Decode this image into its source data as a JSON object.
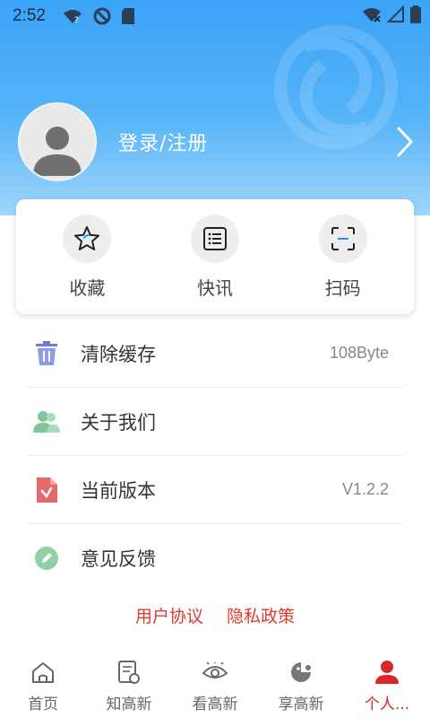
{
  "status_bar": {
    "time": "2:52"
  },
  "profile": {
    "login_label": "登录/注册"
  },
  "quick_actions": [
    {
      "label": "收藏",
      "icon": "star-icon"
    },
    {
      "label": "快讯",
      "icon": "list-icon"
    },
    {
      "label": "扫码",
      "icon": "scan-icon"
    }
  ],
  "menu": [
    {
      "label": "清除缓存",
      "value": "108Byte",
      "icon": "trash-icon"
    },
    {
      "label": "关于我们",
      "value": "",
      "icon": "users-icon"
    },
    {
      "label": "当前版本",
      "value": "V1.2.2",
      "icon": "version-icon"
    },
    {
      "label": "意见反馈",
      "value": "",
      "icon": "feedback-icon"
    }
  ],
  "links": {
    "user_agreement": "用户协议",
    "privacy_policy": "隐私政策"
  },
  "tabs": [
    {
      "label": "首页",
      "icon": "home-icon"
    },
    {
      "label": "知高新",
      "icon": "news-icon"
    },
    {
      "label": "看高新",
      "icon": "eye-icon"
    },
    {
      "label": "享高新",
      "icon": "share-icon"
    },
    {
      "label": "个人...",
      "icon": "person-icon"
    }
  ],
  "colors": {
    "accent_red": "#d8262b",
    "header_blue": "#3ba3f7",
    "link_red": "#e03a2f"
  }
}
